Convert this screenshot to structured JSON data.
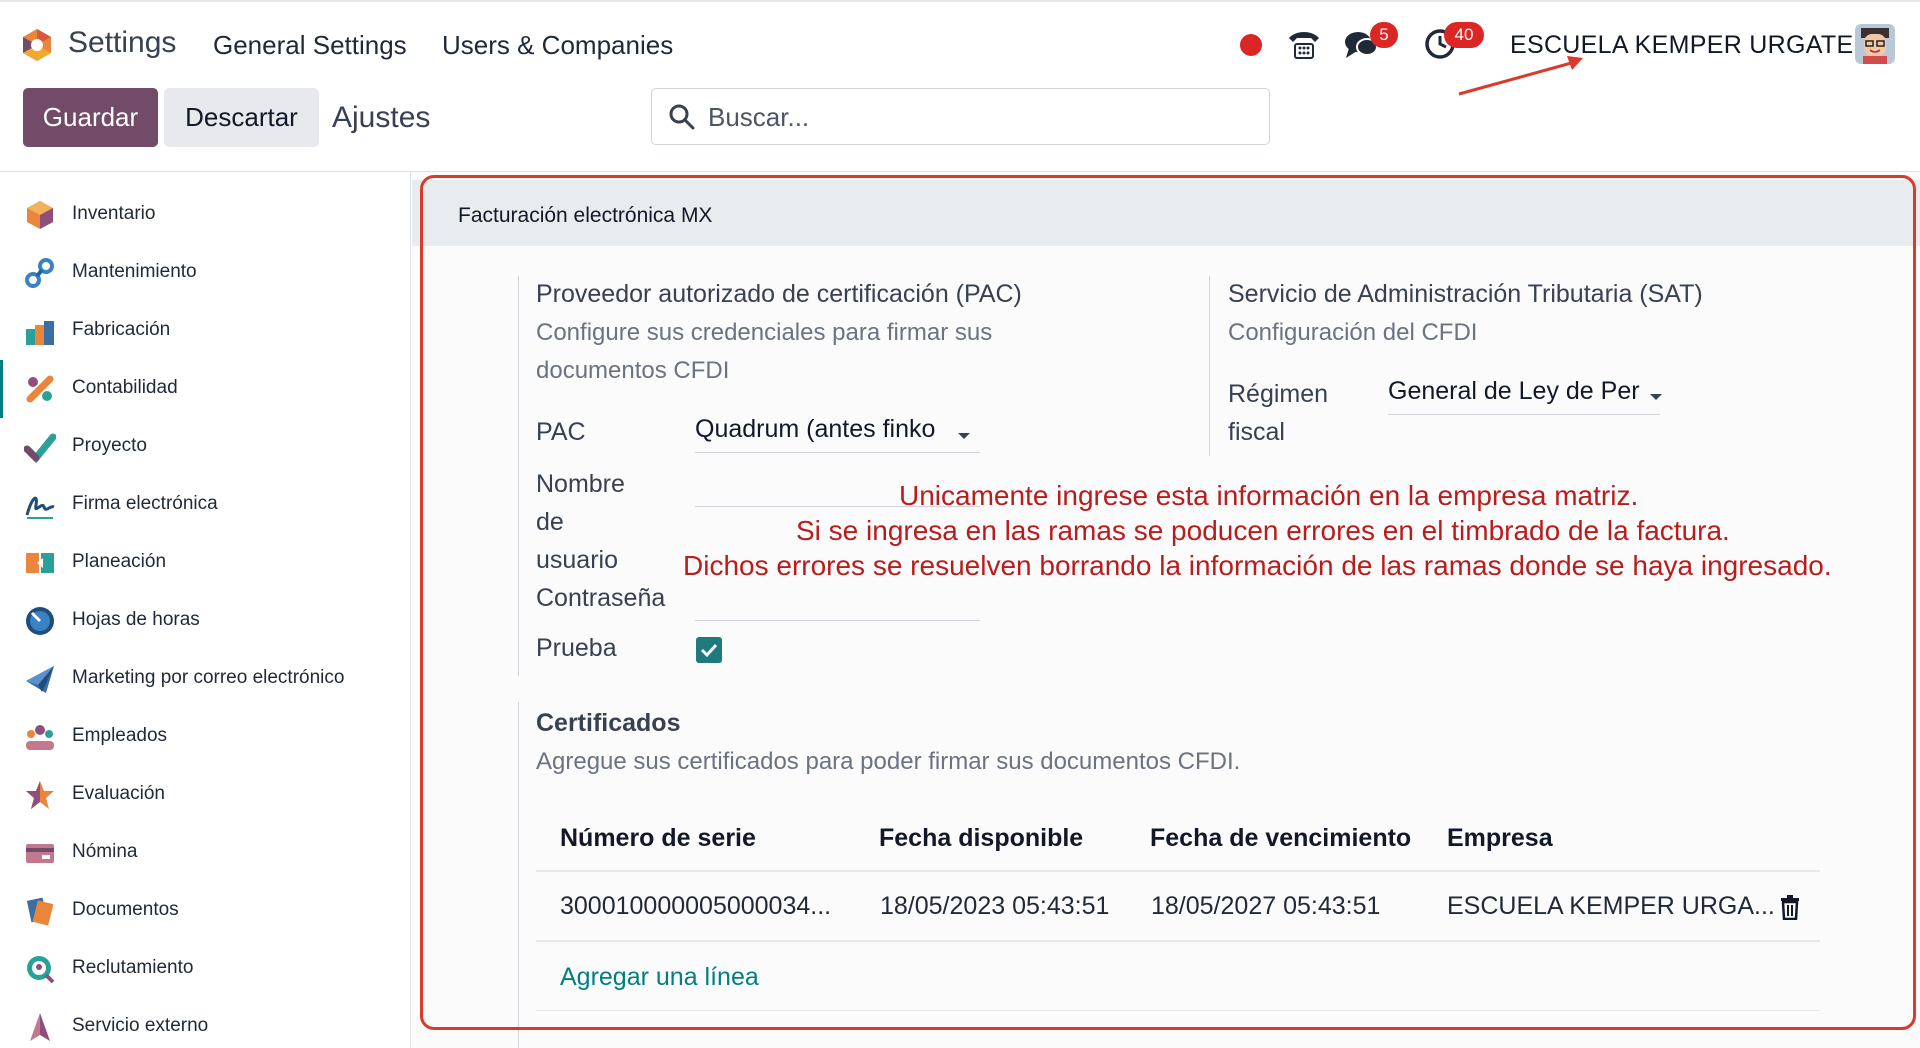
{
  "navbar": {
    "app_title": "Settings",
    "menu": [
      "General Settings",
      "Users & Companies"
    ],
    "chat_badge": "5",
    "activity_badge": "40",
    "company": "ESCUELA KEMPER URGATE"
  },
  "control_panel": {
    "save_label": "Guardar",
    "discard_label": "Descartar",
    "breadcrumb": "Ajustes",
    "search_placeholder": "Buscar..."
  },
  "sidebar": {
    "items": [
      {
        "label": "Inventario",
        "icon": "inventory-icon"
      },
      {
        "label": "Mantenimiento",
        "icon": "maintenance-icon"
      },
      {
        "label": "Fabricación",
        "icon": "manufacturing-icon"
      },
      {
        "label": "Contabilidad",
        "icon": "accounting-icon",
        "active": true
      },
      {
        "label": "Proyecto",
        "icon": "project-icon"
      },
      {
        "label": "Firma electrónica",
        "icon": "sign-icon"
      },
      {
        "label": "Planeación",
        "icon": "planning-icon"
      },
      {
        "label": "Hojas de horas",
        "icon": "timesheets-icon"
      },
      {
        "label": "Marketing por correo electrónico",
        "icon": "email-marketing-icon"
      },
      {
        "label": "Empleados",
        "icon": "employees-icon"
      },
      {
        "label": "Evaluación",
        "icon": "appraisal-icon"
      },
      {
        "label": "Nómina",
        "icon": "payroll-icon"
      },
      {
        "label": "Documentos",
        "icon": "documents-icon"
      },
      {
        "label": "Reclutamiento",
        "icon": "recruitment-icon"
      },
      {
        "label": "Servicio externo",
        "icon": "field-service-icon"
      }
    ]
  },
  "section": {
    "title": "Facturación electrónica MX",
    "pac": {
      "title": "Proveedor autorizado de certificación (PAC)",
      "desc_line1": "Configure sus credenciales para firmar sus",
      "desc_line2": "documentos CFDI",
      "pac_label": "PAC",
      "pac_value": "Quadrum (antes finko",
      "user_label_1": "Nombre",
      "user_label_2": "de",
      "user_label_3": "usuario",
      "password_label": "Contraseña",
      "test_label": "Prueba",
      "test_checked": true
    },
    "sat": {
      "title": "Servicio de Administración Tributaria (SAT)",
      "desc": "Configuración del CFDI",
      "regime_label_1": "Régimen",
      "regime_label_2": "fiscal",
      "regime_value": "General de Ley de Per"
    },
    "note": {
      "line1": "Unicamente ingrese esta información en la empresa matriz.",
      "line2": "Si se ingresa en las ramas se poducen errores en el timbrado de la factura.",
      "line3": "Dichos errores se resuelven borrando la información de las ramas donde se haya ingresado."
    },
    "certificates": {
      "title": "Certificados",
      "desc": "Agregue sus certificados para poder firmar sus documentos CFDI.",
      "columns": [
        "Número de serie",
        "Fecha disponible",
        "Fecha de vencimiento",
        "Empresa"
      ],
      "rows": [
        [
          "300010000005000034...",
          "18/05/2023 05:43:51",
          "18/05/2027 05:43:51",
          "ESCUELA KEMPER URGA..."
        ]
      ],
      "add_line": "Agregar una línea"
    }
  },
  "colors": {
    "brand": "#714b67",
    "accent": "#017e84",
    "annotation": "#d93a2b"
  }
}
